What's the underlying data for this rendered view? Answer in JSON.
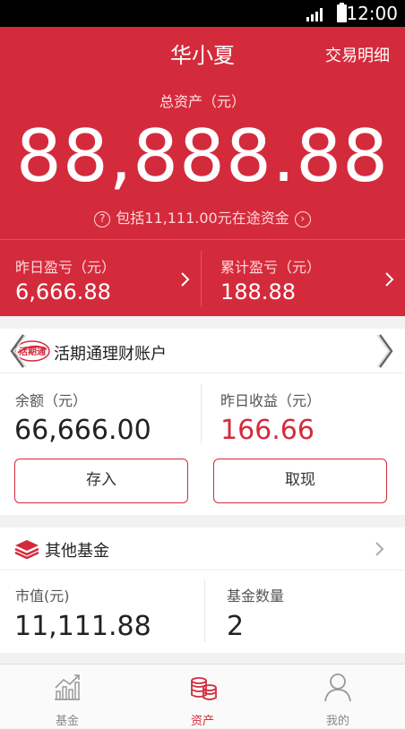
{
  "status_bar": {
    "time": "12:00",
    "icons": [
      "signal-icon",
      "battery-icon"
    ]
  },
  "header": {
    "title": "华小夏",
    "detail_link": "交易明细",
    "total_label": "总资产（元）",
    "total_value": "88,888.88",
    "in_transit_text": "包括11,111.00元在途资金",
    "yesterday_label": "昨日盈亏（元）",
    "yesterday_value": "6,666.88",
    "cumulative_label": "累计盈亏（元）",
    "cumulative_value": "188.88"
  },
  "current_account": {
    "logo_text": "活期通",
    "title": "活期通理财账户",
    "balance_label": "余额（元）",
    "balance_value": "66,666.00",
    "yesterday_income_label": "昨日收益（元）",
    "yesterday_income_value": "166.66",
    "deposit_label": "存入",
    "withdraw_label": "取现"
  },
  "other_funds": {
    "title": "其他基金",
    "market_value_label": "市值(元)",
    "market_value": "11,111.88",
    "fund_count_label": "基金数量",
    "fund_count": "2"
  },
  "tabs": [
    {
      "label": "基金",
      "icon": "chart-icon",
      "active": false
    },
    {
      "label": "资产",
      "icon": "coins-icon",
      "active": true
    },
    {
      "label": "我的",
      "icon": "person-icon",
      "active": false
    }
  ],
  "colors": {
    "brand": "#d42b3c",
    "income": "#d42b3c"
  }
}
